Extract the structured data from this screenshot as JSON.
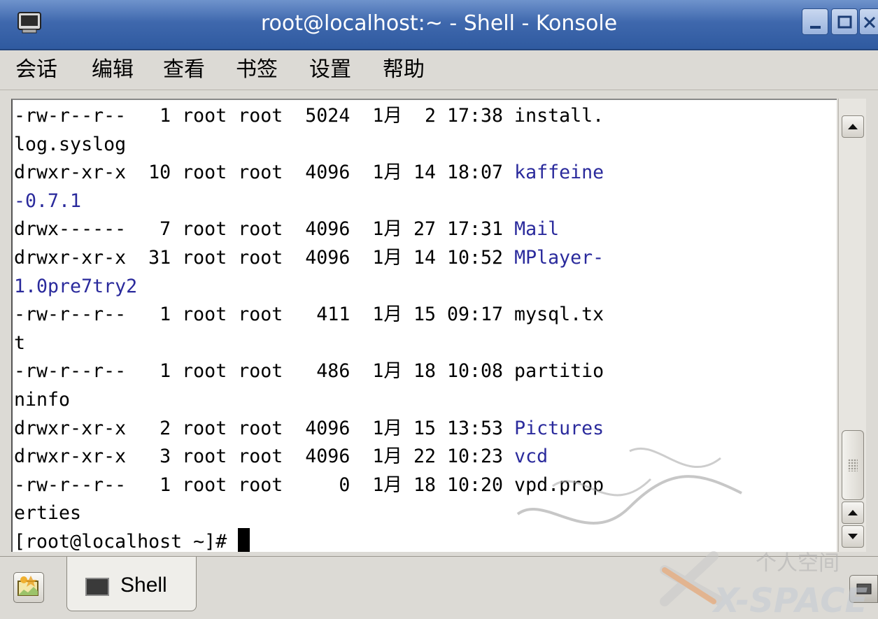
{
  "window": {
    "title": "root@localhost:~ - Shell - Konsole"
  },
  "menu": {
    "items": [
      "会话",
      "编辑",
      "查看",
      "书签",
      "设置",
      "帮助"
    ]
  },
  "terminal": {
    "lines": [
      {
        "text": "-rw-r--r--   1 root root  5024  1月  2 17:38 install.",
        "is_dir": false
      },
      {
        "text": "log.syslog",
        "is_dir": false
      },
      {
        "prefix": "drwxr-xr-x  10 root root  4096  1月 14 18:07 ",
        "name": "kaffeine",
        "is_dir": true
      },
      {
        "text": "-0.7.1",
        "is_dir": true
      },
      {
        "prefix": "drwx------   7 root root  4096  1月 27 17:31 ",
        "name": "Mail",
        "is_dir": true
      },
      {
        "prefix": "drwxr-xr-x  31 root root  4096  1月 14 10:52 ",
        "name": "MPlayer-",
        "is_dir": true
      },
      {
        "text": "1.0pre7try2",
        "is_dir": true
      },
      {
        "text": "-rw-r--r--   1 root root   411  1月 15 09:17 mysql.tx",
        "is_dir": false
      },
      {
        "text": "t",
        "is_dir": false
      },
      {
        "text": "-rw-r--r--   1 root root   486  1月 18 10:08 partitio",
        "is_dir": false
      },
      {
        "text": "ninfo",
        "is_dir": false
      },
      {
        "prefix": "drwxr-xr-x   2 root root  4096  1月 15 13:53 ",
        "name": "Pictures",
        "is_dir": true
      },
      {
        "prefix": "drwxr-xr-x   3 root root  4096  1月 22 10:23 ",
        "name": "vcd",
        "is_dir": true
      },
      {
        "text": "-rw-r--r--   1 root root     0  1月 18 10:20 vpd.prop",
        "is_dir": false
      },
      {
        "text": "erties",
        "is_dir": false
      }
    ],
    "prompt": "[root@localhost ~]# "
  },
  "tabs": [
    {
      "label": "Shell",
      "icon": "terminal-icon",
      "active": true
    }
  ],
  "watermark": {
    "text": "个人空间",
    "logo": "X-SPACE"
  },
  "colors": {
    "titlebar": "#3f68ad",
    "terminal_bg": "#ffffff",
    "terminal_fg": "#000000",
    "directory": "#2a2a9c",
    "chrome": "#dcdad5"
  }
}
